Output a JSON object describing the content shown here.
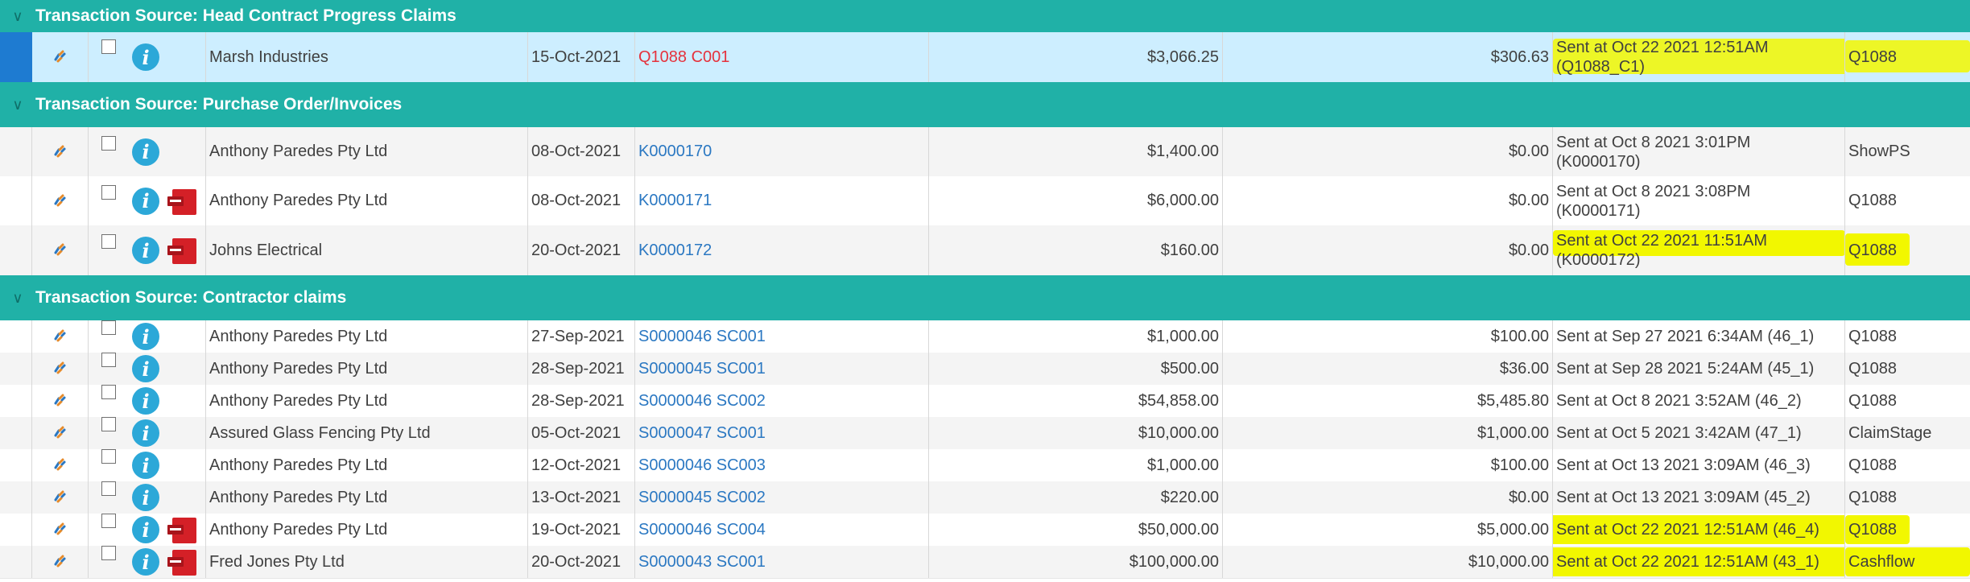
{
  "groups": [
    {
      "title": "Transaction Source: Head Contract Progress Claims",
      "rows": [
        {
          "name": "Marsh Industries",
          "date": "15-Oct-2021",
          "ref": "Q1088 C001",
          "amount": "$3,066.25",
          "gst": "$306.63",
          "sent_line1": "Sent at Oct 22 2021 12:51AM",
          "sent_line2": "(Q1088_C1)",
          "project": "Q1088"
        }
      ]
    },
    {
      "title": "Transaction Source: Purchase Order/Invoices",
      "rows": [
        {
          "name": "Anthony Paredes Pty Ltd",
          "date": "08-Oct-2021",
          "ref": "K0000170",
          "amount": "$1,400.00",
          "gst": "$0.00",
          "sent_line1": "Sent at Oct 8 2021 3:01PM",
          "sent_line2": "(K0000170)",
          "project": "ShowPS"
        },
        {
          "name": "Anthony Paredes Pty Ltd",
          "date": "08-Oct-2021",
          "ref": "K0000171",
          "amount": "$6,000.00",
          "gst": "$0.00",
          "sent_line1": "Sent at Oct 8 2021 3:08PM",
          "sent_line2": "(K0000171)",
          "project": "Q1088"
        },
        {
          "name": "Johns Electrical",
          "date": "20-Oct-2021",
          "ref": "K0000172",
          "amount": "$160.00",
          "gst": "$0.00",
          "sent_line1": "Sent at Oct 22 2021 11:51AM",
          "sent_line2": "(K0000172)",
          "project": "Q1088"
        }
      ]
    },
    {
      "title": "Transaction Source: Contractor claims",
      "rows": [
        {
          "name": "Anthony Paredes Pty Ltd",
          "date": "27-Sep-2021",
          "ref": "S0000046 SC001",
          "amount": "$1,000.00",
          "gst": "$100.00",
          "sent_line1": "Sent at Sep 27 2021 6:34AM (46_1)",
          "project": "Q1088"
        },
        {
          "name": "Anthony Paredes Pty Ltd",
          "date": "28-Sep-2021",
          "ref": "S0000045 SC001",
          "amount": "$500.00",
          "gst": "$36.00",
          "sent_line1": "Sent at Sep 28 2021 5:24AM (45_1)",
          "project": "Q1088"
        },
        {
          "name": "Anthony Paredes Pty Ltd",
          "date": "28-Sep-2021",
          "ref": "S0000046 SC002",
          "amount": "$54,858.00",
          "gst": "$5,485.80",
          "sent_line1": "Sent at Oct 8 2021 3:52AM (46_2)",
          "project": "Q1088"
        },
        {
          "name": "Assured Glass Fencing Pty Ltd",
          "date": "05-Oct-2021",
          "ref": "S0000047 SC001",
          "amount": "$10,000.00",
          "gst": "$1,000.00",
          "sent_line1": "Sent at Oct 5 2021 3:42AM (47_1)",
          "project": "ClaimStage"
        },
        {
          "name": "Anthony Paredes Pty Ltd",
          "date": "12-Oct-2021",
          "ref": "S0000046 SC003",
          "amount": "$1,000.00",
          "gst": "$100.00",
          "sent_line1": "Sent at Oct 13 2021 3:09AM (46_3)",
          "project": "Q1088"
        },
        {
          "name": "Anthony Paredes Pty Ltd",
          "date": "13-Oct-2021",
          "ref": "S0000045 SC002",
          "amount": "$220.00",
          "gst": "$0.00",
          "sent_line1": "Sent at Oct 13 2021 3:09AM (45_2)",
          "project": "Q1088"
        },
        {
          "name": "Anthony Paredes Pty Ltd",
          "date": "19-Oct-2021",
          "ref": "S0000046 SC004",
          "amount": "$50,000.00",
          "gst": "$5,000.00",
          "sent_line1": "Sent at Oct 22 2021 12:51AM (46_4)",
          "project": "Q1088"
        },
        {
          "name": "Fred Jones Pty Ltd",
          "date": "20-Oct-2021",
          "ref": "S0000043 SC001",
          "amount": "$100,000.00",
          "gst": "$10,000.00",
          "sent_line1": "Sent at Oct 22 2021 12:51AM (43_1)",
          "project": "Cashflow"
        }
      ]
    }
  ],
  "icons": {
    "collapse": "chevron-down-icon",
    "link": "link-icon",
    "info": "info-icon",
    "pdf": "pdf-icon",
    "info_glyph": "i"
  },
  "colors": {
    "group_header": "#20b1a7",
    "selected_row": "#cdeeff",
    "selection_marker": "#1e7bd1",
    "ref_link": "#2b78c2",
    "ref_selected": "#e5323c",
    "highlight": "#f2f700",
    "info": "#2ca8d8",
    "pdf": "#d42027"
  }
}
